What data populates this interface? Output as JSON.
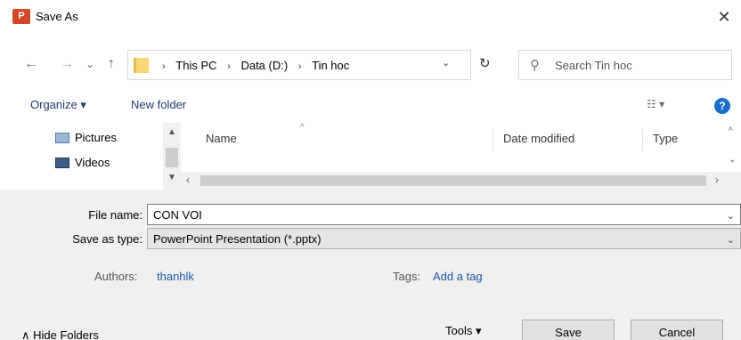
{
  "window": {
    "app_badge": "P",
    "title": "Save As",
    "close_glyph": "✕"
  },
  "nav": {
    "back_glyph": "←",
    "forward_glyph": "→",
    "recent_glyph": "⌄",
    "up_glyph": "↑",
    "breadcrumbs": [
      "This PC",
      "Data (D:)",
      "Tin hoc"
    ],
    "breadcrumb_sep": "›",
    "address_dropdown_glyph": "⌄",
    "refresh_glyph": "↻",
    "search_placeholder": "Search Tin hoc",
    "search_glyph": "⚲"
  },
  "commands": {
    "organize": "Organize ▾",
    "new_folder": "New folder",
    "view_glyph": "☷ ▾",
    "help_glyph": "?"
  },
  "sidebar": {
    "items": [
      {
        "label": "Pictures",
        "icon": "pictures-icon"
      },
      {
        "label": "Videos",
        "icon": "videos-icon"
      }
    ]
  },
  "files": {
    "columns": [
      "Name",
      "Date modified",
      "Type"
    ],
    "sort_glyph": "^"
  },
  "form": {
    "file_name_label": "File name:",
    "file_name_value": "CON VOI",
    "save_type_label": "Save as type:",
    "save_type_value": "PowerPoint Presentation (*.pptx)",
    "authors_label": "Authors:",
    "authors_value": "thanhlk",
    "tags_label": "Tags:",
    "tags_value": "Add a tag"
  },
  "footer": {
    "hide_folders": "∧  Hide Folders",
    "tools": "Tools  ▾",
    "save": "Save",
    "cancel": "Cancel"
  },
  "colors": {
    "accent": "#1a6fc9",
    "link": "#1a5aa6",
    "app_icon": "#d24726",
    "folder": "#f8d775"
  }
}
